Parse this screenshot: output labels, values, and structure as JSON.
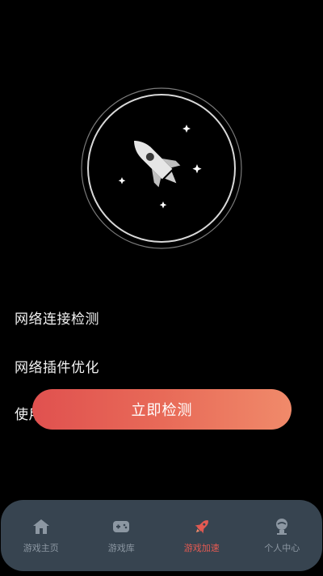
{
  "checks": [
    {
      "label": "网络连接检测"
    },
    {
      "label": "网络插件优化"
    },
    {
      "label": "使用"
    }
  ],
  "action_button": {
    "label": "立即检测"
  },
  "tabbar": {
    "items": [
      {
        "label": "游戏主页",
        "icon": "home-icon"
      },
      {
        "label": "游戏库",
        "icon": "gamepad-icon"
      },
      {
        "label": "游戏加速",
        "icon": "rocket-icon",
        "active": true
      },
      {
        "label": "个人中心",
        "icon": "user-icon"
      }
    ]
  },
  "colors": {
    "accent_start": "#e0514f",
    "accent_end": "#f08a6a",
    "tab_active": "#e45a52",
    "tabbar_bg": "#374450"
  }
}
